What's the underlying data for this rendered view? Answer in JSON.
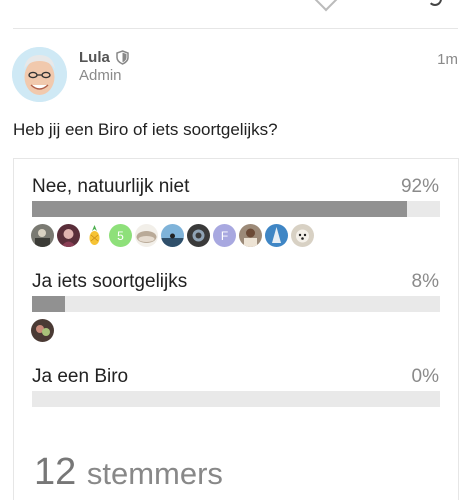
{
  "post": {
    "author": "Lula",
    "role": "Admin",
    "time": "1m",
    "question": "Heb jij een Biro of iets soortgelijks?"
  },
  "poll": {
    "options": [
      {
        "label": "Nee, natuurlijk niet",
        "percent_text": "92%",
        "percent": 92,
        "voters": [
          "photo",
          "photo",
          "pineapple",
          "5",
          "hedgehog",
          "photo",
          "photo",
          "F",
          "photo",
          "photo",
          "dog"
        ]
      },
      {
        "label": "Ja iets soortgelijks",
        "percent_text": "8%",
        "percent": 8,
        "voters": [
          "photo"
        ]
      },
      {
        "label": "Ja een Biro",
        "percent_text": "0%",
        "percent": 0,
        "voters": []
      }
    ],
    "total_number": "12",
    "total_label": "stemmers"
  },
  "colors": {
    "bar_fill": "#919191",
    "bar_track": "#e9e9e9",
    "voter_5": "#8ee07a",
    "voter_F": "#a8a8e0"
  }
}
